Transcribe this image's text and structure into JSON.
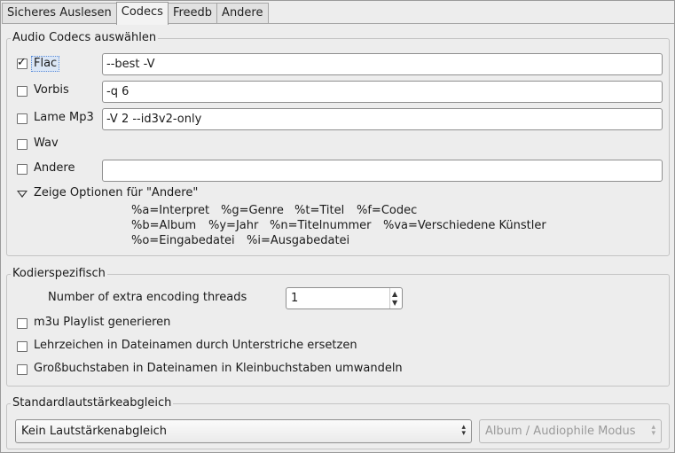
{
  "tabs": [
    {
      "label": "Sicheres Auslesen",
      "active": false
    },
    {
      "label": "Codecs",
      "active": true
    },
    {
      "label": "Freedb",
      "active": false
    },
    {
      "label": "Andere",
      "active": false
    }
  ],
  "audio_codecs": {
    "title": "Audio Codecs auswählen",
    "codecs": [
      {
        "label": "Flac",
        "checked": true,
        "options": "--best -V"
      },
      {
        "label": "Vorbis",
        "checked": false,
        "options": "-q 6"
      },
      {
        "label": "Lame Mp3",
        "checked": false,
        "options": "-V 2 --id3v2-only"
      },
      {
        "label": "Wav",
        "checked": false
      },
      {
        "label": "Andere",
        "checked": false,
        "options": ""
      }
    ],
    "expander_label": "Zeige Optionen für \"Andere\"",
    "hints": [
      [
        "%a=Interpret",
        "%g=Genre",
        "%t=Titel",
        "%f=Codec"
      ],
      [
        "%b=Album",
        "%y=Jahr",
        "%n=Titelnummer",
        "%va=Verschiedene Künstler"
      ],
      [
        "%o=Eingabedatei",
        "%i=Ausgabedatei"
      ]
    ],
    "check_glyph": "✓"
  },
  "encoder_specific": {
    "title": "Kodierspezifisch",
    "threads_label": "Number of extra encoding threads",
    "threads_value": "1",
    "options": [
      {
        "label": "m3u Playlist generieren",
        "checked": false
      },
      {
        "label": "Lehrzeichen in Dateinamen durch Unterstriche ersetzen",
        "checked": false
      },
      {
        "label": "Großbuchstaben in Dateinamen in Kleinbuchstaben umwandeln",
        "checked": false
      }
    ]
  },
  "volume": {
    "title": "Standardlautstärkeabgleich",
    "mode_value": "Kein Lautstärkenabgleich",
    "secondary_value": "Album / Audiophile Modus"
  },
  "icons": {
    "spin_up": "▲",
    "spin_down": "▼",
    "combo_up": "⌃",
    "combo_down": "⌄"
  }
}
